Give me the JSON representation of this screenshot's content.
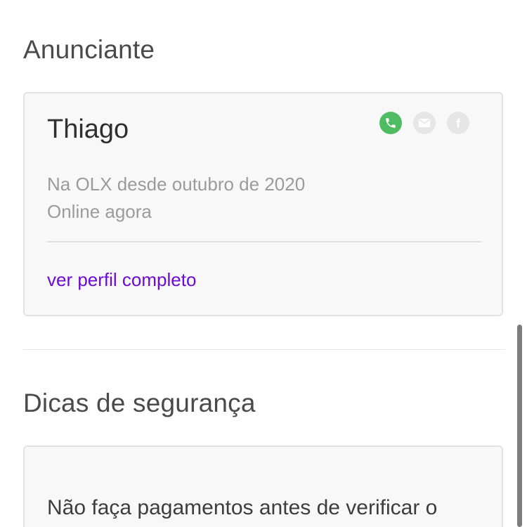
{
  "advertiser_section": {
    "title": "Anunciante",
    "seller_name": "Thiago",
    "member_since": "Na OLX desde outubro de 2020",
    "online_status": "Online agora",
    "profile_link": "ver perfil completo",
    "contact_icons": {
      "phone": "phone-icon",
      "email": "mail-icon",
      "facebook": "facebook-icon"
    }
  },
  "safety_section": {
    "title": "Dicas de segurança",
    "tip_text": "Não faça pagamentos antes de verificar o"
  },
  "colors": {
    "phone_green": "#4fbb62",
    "link_purple": "#6e0ad6",
    "card_background": "#f8f8f8",
    "muted_icon": "#e6e6e6"
  }
}
